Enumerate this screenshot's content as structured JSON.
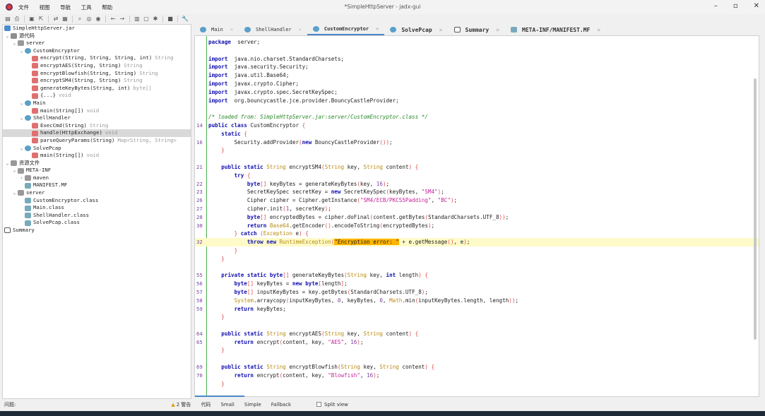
{
  "window": {
    "title": "*SimpleHttpServer - jadx-gui"
  },
  "menu": [
    "文件",
    "视图",
    "导航",
    "工具",
    "帮助"
  ],
  "toolbar_icons": [
    "open-icon",
    "save-all-icon",
    "save-icon",
    "export-icon",
    "sync-icon",
    "flatten-icon",
    "search-icon",
    "find-class-icon",
    "find-usage-icon",
    "back-icon",
    "forward-icon",
    "decompile-icon",
    "deobfuscation-icon",
    "debug-icon",
    "log-icon",
    "settings-icon"
  ],
  "tree": [
    {
      "d": 0,
      "ic": "jar",
      "label": "SimpleHttpServer.jar"
    },
    {
      "d": 0,
      "ch": "v",
      "ic": "pkg",
      "label": "源代码"
    },
    {
      "d": 1,
      "ch": "v",
      "ic": "fold",
      "label": "server"
    },
    {
      "d": 2,
      "ch": "v",
      "ic": "cls",
      "label": "CustomEncryptor"
    },
    {
      "d": 3,
      "ic": "m",
      "label": "encrypt(String, String, String, int)",
      "type": "String"
    },
    {
      "d": 3,
      "ic": "m",
      "label": "encryptAES(String, String)",
      "type": "String"
    },
    {
      "d": 3,
      "ic": "m",
      "label": "encryptBlowfish(String, String)",
      "type": "String"
    },
    {
      "d": 3,
      "ic": "m",
      "label": "encryptSM4(String, String)",
      "type": "String"
    },
    {
      "d": 3,
      "ic": "m",
      "label": "generateKeyBytes(String, int)",
      "type": "byte[]"
    },
    {
      "d": 3,
      "ic": "m",
      "label": "{...}",
      "type": "void"
    },
    {
      "d": 2,
      "ch": "v",
      "ic": "cls",
      "label": "Main"
    },
    {
      "d": 3,
      "ic": "m",
      "label": "main(String[])",
      "type": "void"
    },
    {
      "d": 2,
      "ch": "v",
      "ic": "cls",
      "label": "ShellHandler"
    },
    {
      "d": 3,
      "ic": "m",
      "label": "ExecCmd(String)",
      "type": "String"
    },
    {
      "d": 3,
      "ic": "m",
      "label": "handle(HttpExchange)",
      "type": "void",
      "sel": true
    },
    {
      "d": 3,
      "ic": "m",
      "label": "parseQueryParams(String)",
      "type": "Map<String, String>"
    },
    {
      "d": 2,
      "ch": "v",
      "ic": "cls",
      "label": "SolvePcap"
    },
    {
      "d": 3,
      "ic": "m",
      "label": "main(String[])",
      "type": "void"
    },
    {
      "d": 0,
      "ch": "v",
      "ic": "fold",
      "label": "资源文件"
    },
    {
      "d": 1,
      "ch": "v",
      "ic": "fold",
      "label": "META-INF"
    },
    {
      "d": 2,
      "ch": ">",
      "ic": "fold",
      "label": "maven"
    },
    {
      "d": 2,
      "ic": "file",
      "label": "MANIFEST.MF"
    },
    {
      "d": 1,
      "ch": "v",
      "ic": "fold",
      "label": "server"
    },
    {
      "d": 2,
      "ic": "file",
      "label": "CustomEncryptor.class"
    },
    {
      "d": 2,
      "ic": "file",
      "label": "Main.class"
    },
    {
      "d": 2,
      "ic": "file",
      "label": "ShellHandler.class"
    },
    {
      "d": 2,
      "ic": "file",
      "label": "SolvePcap.class"
    },
    {
      "d": 0,
      "ic": "sum",
      "label": "Summary"
    }
  ],
  "tabs": [
    {
      "label": "Main",
      "ic": "cls"
    },
    {
      "label": "ShellHandler",
      "ic": "cls"
    },
    {
      "label": "CustomEncryptor",
      "ic": "cls",
      "active": true
    },
    {
      "label": "SolvePcap",
      "ic": "cls",
      "big": true
    },
    {
      "label": "Summary",
      "ic": "sum",
      "big": true
    },
    {
      "label": "META-INF/MANIFEST.MF",
      "ic": "file",
      "big": true
    }
  ],
  "code": [
    {
      "n": "",
      "t": [
        [
          "kw",
          "package"
        ],
        [
          "",
          "  server;"
        ]
      ]
    },
    {
      "n": "",
      "t": []
    },
    {
      "n": "",
      "t": [
        [
          "kw",
          "import"
        ],
        [
          "",
          "  java.nio.charset.StandardCharsets;"
        ]
      ]
    },
    {
      "n": "",
      "t": [
        [
          "kw",
          "import"
        ],
        [
          "",
          "  java.security.Security;"
        ]
      ]
    },
    {
      "n": "",
      "t": [
        [
          "kw",
          "import"
        ],
        [
          "",
          "  java.util.Base64;"
        ]
      ]
    },
    {
      "n": "",
      "t": [
        [
          "kw",
          "import"
        ],
        [
          "",
          "  javax.crypto.Cipher;"
        ]
      ]
    },
    {
      "n": "",
      "t": [
        [
          "kw",
          "import"
        ],
        [
          "",
          "  javax.crypto.spec.SecretKeySpec;"
        ]
      ]
    },
    {
      "n": "",
      "t": [
        [
          "kw",
          "import"
        ],
        [
          "",
          "  org.bouncycastle.jce.provider.BouncyCastleProvider;"
        ]
      ]
    },
    {
      "n": "",
      "t": []
    },
    {
      "n": "",
      "t": [
        [
          "cm",
          "/* loaded from: SimpleHttpServer.jar:server/CustomEncryptor.class */"
        ]
      ]
    },
    {
      "n": "14",
      "t": [
        [
          "kw",
          "public class"
        ],
        [
          "",
          " CustomEncryptor "
        ],
        [
          "br",
          "{"
        ]
      ]
    },
    {
      "n": "",
      "t": [
        [
          "",
          "    "
        ],
        [
          "kw",
          "static"
        ],
        [
          "",
          " "
        ],
        [
          "br",
          "{"
        ]
      ]
    },
    {
      "n": "16",
      "t": [
        [
          "",
          "        Security.addProvider"
        ],
        [
          "br",
          "("
        ],
        [
          "kw",
          "new"
        ],
        [
          "",
          " BouncyCastleProvider"
        ],
        [
          "br",
          "())"
        ],
        [
          "",
          ";"
        ]
      ]
    },
    {
      "n": "",
      "t": [
        [
          "",
          "    "
        ],
        [
          "br",
          "}"
        ]
      ]
    },
    {
      "n": "",
      "t": []
    },
    {
      "n": "21",
      "t": [
        [
          "",
          "    "
        ],
        [
          "kw",
          "public static"
        ],
        [
          "",
          " "
        ],
        [
          "ty",
          "String"
        ],
        [
          "",
          " encryptSM4"
        ],
        [
          "br",
          "("
        ],
        [
          "ty",
          "String"
        ],
        [
          "",
          " key, "
        ],
        [
          "ty",
          "String"
        ],
        [
          "",
          " content"
        ],
        [
          "br",
          ")"
        ],
        [
          "",
          " "
        ],
        [
          "br",
          "{"
        ]
      ]
    },
    {
      "n": "",
      "t": [
        [
          "",
          "        "
        ],
        [
          "kw",
          "try"
        ],
        [
          "",
          " "
        ],
        [
          "br",
          "{"
        ]
      ]
    },
    {
      "n": "22",
      "t": [
        [
          "",
          "            "
        ],
        [
          "kw",
          "byte"
        ],
        [
          "br",
          "[]"
        ],
        [
          "",
          " keyBytes = generateKeyBytes"
        ],
        [
          "br",
          "("
        ],
        [
          "",
          "key, "
        ],
        [
          "nu",
          "16"
        ],
        [
          "br",
          ")"
        ],
        [
          "",
          ";"
        ]
      ]
    },
    {
      "n": "23",
      "t": [
        [
          "",
          "            SecretKeySpec secretKey = "
        ],
        [
          "kw",
          "new"
        ],
        [
          "",
          " SecretKeySpec"
        ],
        [
          "br",
          "("
        ],
        [
          "",
          "keyBytes, "
        ],
        [
          "st",
          "\"SM4\""
        ],
        [
          "br",
          ")"
        ],
        [
          "",
          ";"
        ]
      ]
    },
    {
      "n": "26",
      "t": [
        [
          "",
          "            Cipher cipher = Cipher.getInstance"
        ],
        [
          "br",
          "("
        ],
        [
          "st",
          "\"SM4/ECB/PKCS5Padding\""
        ],
        [
          "",
          ", "
        ],
        [
          "st",
          "\"BC\""
        ],
        [
          "br",
          ")"
        ],
        [
          "",
          ";"
        ]
      ]
    },
    {
      "n": "27",
      "t": [
        [
          "",
          "            cipher.init"
        ],
        [
          "br",
          "("
        ],
        [
          "nu",
          "1"
        ],
        [
          "",
          ", secretKey"
        ],
        [
          "br",
          ")"
        ],
        [
          "",
          ";"
        ]
      ]
    },
    {
      "n": "28",
      "t": [
        [
          "",
          "            "
        ],
        [
          "kw",
          "byte"
        ],
        [
          "br",
          "[]"
        ],
        [
          "",
          " encryptedBytes = cipher.doFinal"
        ],
        [
          "br",
          "("
        ],
        [
          "",
          "content.getBytes"
        ],
        [
          "br",
          "("
        ],
        [
          "",
          "StandardCharsets.UTF_8"
        ],
        [
          "br",
          "))"
        ],
        [
          "",
          ";"
        ]
      ]
    },
    {
      "n": "30",
      "t": [
        [
          "",
          "            "
        ],
        [
          "kw",
          "return"
        ],
        [
          "",
          " "
        ],
        [
          "ty",
          "Base64"
        ],
        [
          "",
          ".getEncoder"
        ],
        [
          "br",
          "()"
        ],
        [
          "",
          ".encodeToString"
        ],
        [
          "br",
          "("
        ],
        [
          "",
          "encryptedBytes"
        ],
        [
          "br",
          ")"
        ],
        [
          "",
          ";"
        ]
      ]
    },
    {
      "n": "",
      "t": [
        [
          "",
          "        "
        ],
        [
          "br",
          "}"
        ],
        [
          "",
          " "
        ],
        [
          "kw",
          "catch"
        ],
        [
          "",
          " "
        ],
        [
          "br",
          "("
        ],
        [
          "ty",
          "Exception"
        ],
        [
          "",
          " e"
        ],
        [
          "br",
          ")"
        ],
        [
          "",
          " "
        ],
        [
          "br",
          "{"
        ]
      ]
    },
    {
      "n": "32",
      "hl": true,
      "t": [
        [
          "",
          "            "
        ],
        [
          "kw",
          "throw new"
        ],
        [
          "",
          " "
        ],
        [
          "ty",
          "RuntimeException"
        ],
        [
          "br",
          "("
        ],
        [
          "sh",
          "\"Encryption error: \""
        ],
        [
          "",
          " + e.getMessage"
        ],
        [
          "br",
          "()"
        ],
        [
          "",
          ", e"
        ],
        [
          "br",
          ")"
        ],
        [
          "",
          ";"
        ]
      ]
    },
    {
      "n": "",
      "t": [
        [
          "",
          "        "
        ],
        [
          "br",
          "}"
        ]
      ]
    },
    {
      "n": "",
      "t": [
        [
          "",
          "    "
        ],
        [
          "br",
          "}"
        ]
      ]
    },
    {
      "n": "",
      "t": []
    },
    {
      "n": "55",
      "t": [
        [
          "",
          "    "
        ],
        [
          "kw",
          "private static byte"
        ],
        [
          "br",
          "[]"
        ],
        [
          "",
          " generateKeyBytes"
        ],
        [
          "br",
          "("
        ],
        [
          "ty",
          "String"
        ],
        [
          "",
          " key, "
        ],
        [
          "kw",
          "int"
        ],
        [
          "",
          " length"
        ],
        [
          "br",
          ")"
        ],
        [
          "",
          " "
        ],
        [
          "br",
          "{"
        ]
      ]
    },
    {
      "n": "56",
      "t": [
        [
          "",
          "        "
        ],
        [
          "kw",
          "byte"
        ],
        [
          "br",
          "[]"
        ],
        [
          "",
          " keyBytes = "
        ],
        [
          "kw",
          "new byte"
        ],
        [
          "br",
          "["
        ],
        [
          "",
          "length"
        ],
        [
          "br",
          "]"
        ],
        [
          "",
          ";"
        ]
      ]
    },
    {
      "n": "57",
      "t": [
        [
          "",
          "        "
        ],
        [
          "kw",
          "byte"
        ],
        [
          "br",
          "[]"
        ],
        [
          "",
          " inputKeyBytes = key.getBytes"
        ],
        [
          "br",
          "("
        ],
        [
          "",
          "StandardCharsets.UTF_8"
        ],
        [
          "br",
          ")"
        ],
        [
          "",
          ";"
        ]
      ]
    },
    {
      "n": "58",
      "t": [
        [
          "",
          "        "
        ],
        [
          "ty",
          "System"
        ],
        [
          "",
          ".arraycopy"
        ],
        [
          "br",
          "("
        ],
        [
          "",
          "inputKeyBytes, "
        ],
        [
          "nu",
          "0"
        ],
        [
          "",
          ", keyBytes, "
        ],
        [
          "nu",
          "0"
        ],
        [
          "",
          ", "
        ],
        [
          "ty",
          "Math"
        ],
        [
          "",
          ".min"
        ],
        [
          "br",
          "("
        ],
        [
          "",
          "inputKeyBytes.length, length"
        ],
        [
          "br",
          "))"
        ],
        [
          "",
          ";"
        ]
      ]
    },
    {
      "n": "59",
      "t": [
        [
          "",
          "        "
        ],
        [
          "kw",
          "return"
        ],
        [
          "",
          " keyBytes;"
        ]
      ]
    },
    {
      "n": "",
      "t": [
        [
          "",
          "    "
        ],
        [
          "br",
          "}"
        ]
      ]
    },
    {
      "n": "",
      "t": []
    },
    {
      "n": "64",
      "t": [
        [
          "",
          "    "
        ],
        [
          "kw",
          "public static"
        ],
        [
          "",
          " "
        ],
        [
          "ty",
          "String"
        ],
        [
          "",
          " encryptAES"
        ],
        [
          "br",
          "("
        ],
        [
          "ty",
          "String"
        ],
        [
          "",
          " key, "
        ],
        [
          "ty",
          "String"
        ],
        [
          "",
          " content"
        ],
        [
          "br",
          ")"
        ],
        [
          "",
          " "
        ],
        [
          "br",
          "{"
        ]
      ]
    },
    {
      "n": "65",
      "t": [
        [
          "",
          "        "
        ],
        [
          "kw",
          "return"
        ],
        [
          "",
          " encrypt"
        ],
        [
          "br",
          "("
        ],
        [
          "",
          "content, key, "
        ],
        [
          "st",
          "\"AES\""
        ],
        [
          "",
          ", "
        ],
        [
          "nu",
          "16"
        ],
        [
          "br",
          ")"
        ],
        [
          "",
          ";"
        ]
      ]
    },
    {
      "n": "",
      "t": [
        [
          "",
          "    "
        ],
        [
          "br",
          "}"
        ]
      ]
    },
    {
      "n": "",
      "t": []
    },
    {
      "n": "69",
      "t": [
        [
          "",
          "    "
        ],
        [
          "kw",
          "public static"
        ],
        [
          "",
          " "
        ],
        [
          "ty",
          "String"
        ],
        [
          "",
          " encryptBlowfish"
        ],
        [
          "br",
          "("
        ],
        [
          "ty",
          "String"
        ],
        [
          "",
          " key, "
        ],
        [
          "ty",
          "String"
        ],
        [
          "",
          " content"
        ],
        [
          "br",
          ")"
        ],
        [
          "",
          " "
        ],
        [
          "br",
          "{"
        ]
      ]
    },
    {
      "n": "70",
      "t": [
        [
          "",
          "        "
        ],
        [
          "kw",
          "return"
        ],
        [
          "",
          " encrypt"
        ],
        [
          "br",
          "("
        ],
        [
          "",
          "content, key, "
        ],
        [
          "st",
          "\"Blowfish\""
        ],
        [
          "",
          ", "
        ],
        [
          "nu",
          "16"
        ],
        [
          "br",
          ")"
        ],
        [
          "",
          ";"
        ]
      ]
    },
    {
      "n": "",
      "t": [
        [
          "",
          "    "
        ],
        [
          "br",
          "}"
        ]
      ]
    }
  ],
  "status": {
    "problems": "问题:",
    "warnings": "2 警告",
    "modes": [
      "代码",
      "Smali",
      "Simple",
      "Fallback"
    ],
    "split_view": "Split view"
  }
}
